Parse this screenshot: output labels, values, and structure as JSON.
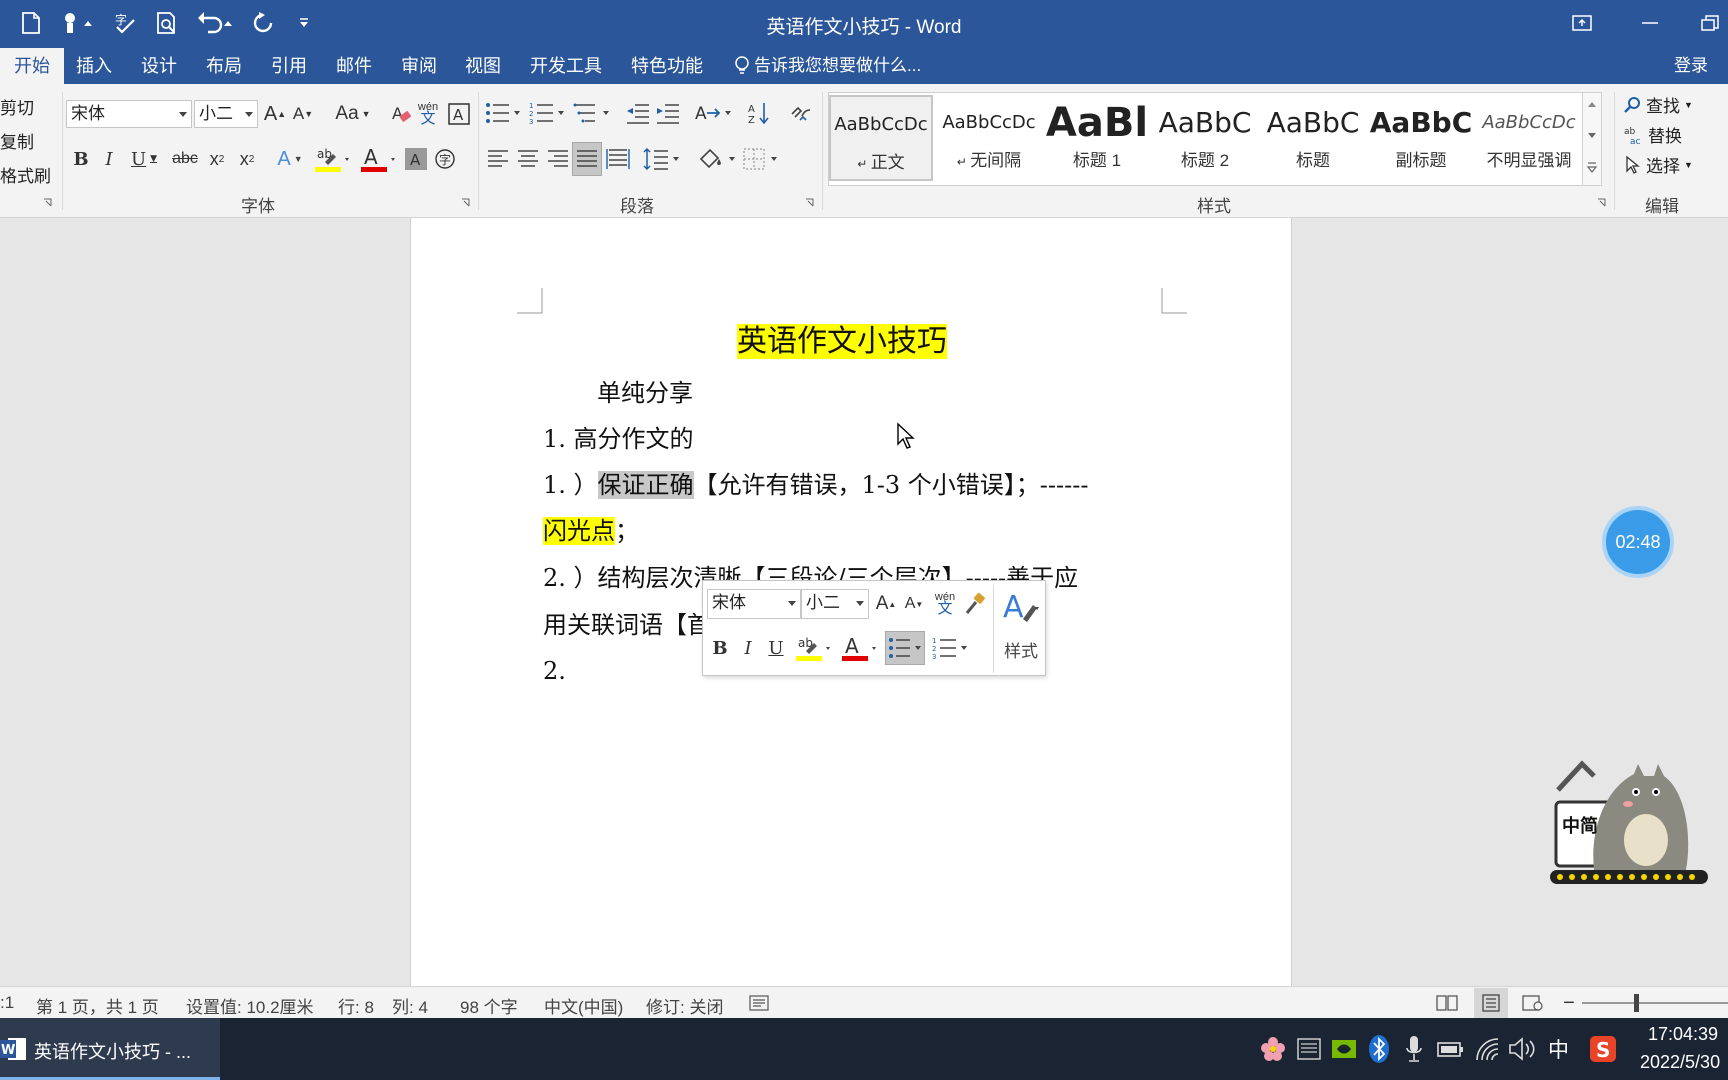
{
  "window": {
    "title": "英语作文小技巧 - Word"
  },
  "tabs": [
    "开始",
    "插入",
    "设计",
    "布局",
    "引用",
    "邮件",
    "审阅",
    "视图",
    "开发工具",
    "特色功能"
  ],
  "tell_me": "告诉我您想要做什么...",
  "login": "登录",
  "clipboard": {
    "cut": "剪切",
    "copy": "复制",
    "painter": "格式刷"
  },
  "font": {
    "name": "宋体",
    "size": "小二",
    "group_label": "字体",
    "case_btn": "Aa",
    "phonetic": "wén"
  },
  "paragraph": {
    "group_label": "段落"
  },
  "styles": {
    "group_label": "样式",
    "items": [
      {
        "sample": "AaBbCcDc",
        "name": "正文"
      },
      {
        "sample": "AaBbCcDc",
        "name": "无间隔"
      },
      {
        "sample": "AaBl",
        "name": "标题 1"
      },
      {
        "sample": "AaBbC",
        "name": "标题 2"
      },
      {
        "sample": "AaBbC",
        "name": "标题"
      },
      {
        "sample": "AaBbC",
        "name": "副标题"
      },
      {
        "sample": "AaBbCcDc",
        "name": "不明显强调"
      }
    ]
  },
  "editing": {
    "group_label": "编辑",
    "find": "查找",
    "replace": "替换",
    "select": "选择"
  },
  "document": {
    "title": "英语作文小技巧",
    "line2": "单纯分享",
    "line3": "1. 高分作文的",
    "line4_prefix": "1. ）",
    "line4_sel": "保证正确",
    "line4_rest": "【允许有错误，1-3 个小错误】；------",
    "line5_hl": "闪光点",
    "line5_rest": "；",
    "line6": "2. ）结构层次清晰【三段论/三个层次】-----善于应",
    "line7": "用关联词语【首先、其次、最后、总之】；",
    "line8": "2."
  },
  "mini_toolbar": {
    "font": "宋体",
    "size": "小二",
    "styles": "样式",
    "phonetic": "wén"
  },
  "timer": "02:48",
  "mascot_text": "中简",
  "status": {
    "col_pos": ":1",
    "page": "第 1 页，共 1 页",
    "setting": "设置值: 10.2厘米",
    "line": "行: 8",
    "column": "列: 4",
    "words": "98 个字",
    "lang": "中文(中国)",
    "track": "修订: 关闭"
  },
  "taskbar": {
    "app": "英语作文小技巧 - ...",
    "ime": "中",
    "time": "17:04:39",
    "date": "2022/5/30"
  },
  "colors": {
    "accent": "#2b579a",
    "highlight": "#ffff00",
    "font_red": "#e00000"
  }
}
